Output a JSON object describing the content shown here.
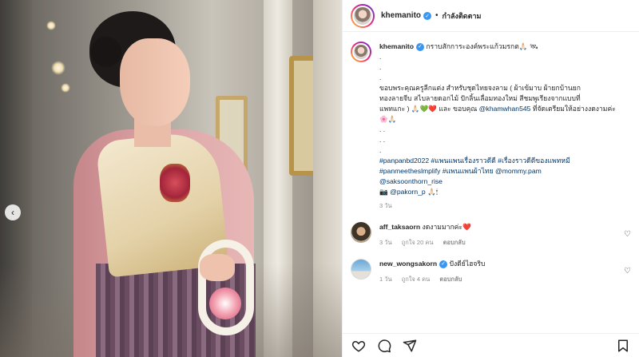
{
  "post": {
    "username": "khemanito",
    "follow_label": "กำลังติดตาม",
    "separator": "•"
  },
  "caption": {
    "username": "khemanito",
    "title": "กราบสักการะองค์พระแก้วมรกต🙏🏻 🛰",
    "lines": [
      ".",
      ".",
      ".",
      "ขอบพระคุณครูลีกแต่ง สำหรับชุดไทยจงลาม ( ผ้าเข้มาบ ผ้ายกบ้านยก",
      "ทองลายจีบ สไบลายดอกไม้ ปักลิ้นเลื่อมทองใหม่ สีชมพูเรียงจากแบบที่",
      "แพทแกะ )",
      ". .",
      ". .",
      "."
    ],
    "thanks_prefix": "และ ขอบคุณ",
    "thanks_mention": "@khamwhan545",
    "thanks_suffix": "ที่จัดเตรียมให้อย่างงดงามค่ะ 🌸🙏🏻",
    "hashtags_1": "#panpanbd2022 #แพนแพนเรื่องราวดีดี #เรื่องราวดีดีของแพทหมี",
    "hashtags_2": "#panmeetheslmplify #แพนแพนผ้าไทย",
    "mention_1": "@mommy.pam",
    "mention_2": "@saksoonthorn_rise",
    "mention_3_prefix": "📷",
    "mention_3": "@pakorn_p",
    "mention_3_suffix": "🙏🏻🕯",
    "time": "3 วัน"
  },
  "comments": [
    {
      "username": "aff_taksaorn",
      "text": "งดงามมากค่ะ❤️",
      "time": "3 วัน",
      "likes": "ถูกใจ 20 คน",
      "reply": "ตอบกลับ"
    },
    {
      "username": "new_wongsakorn",
      "text": "ปังดีย์ไฮจริบ",
      "time": "1 วัน",
      "likes": "ถูกใจ 4 คน",
      "reply": "ตอบกลับ"
    }
  ],
  "icons": {
    "carousel_prev": "chevron-left-icon",
    "like": "heart-icon",
    "comment": "comment-icon",
    "share": "share-icon",
    "save": "bookmark-icon"
  },
  "colors": {
    "verified": "#3897f0",
    "link": "#00376b",
    "muted": "#8e8e8e"
  }
}
